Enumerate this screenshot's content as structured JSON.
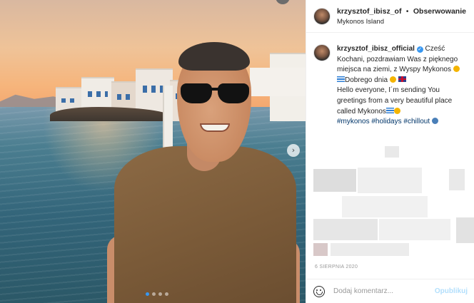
{
  "post": {
    "username": "krzysztof_ibisz_of",
    "bullet": "•",
    "follow_label": "Obserwowanie",
    "location": "Mykonos Island"
  },
  "caption": {
    "username": "krzysztof_ibisz_official",
    "verified_glyph": "✓",
    "line1": " Cześć Kochani, pozdrawiam Was z pięknego miejsca na ziemi, z Wyspy Mykonos",
    "line2": "Dobrego dnia",
    "line3": "Hello everyone, I´m sending You greetings from a very beautiful place called Mykonos",
    "hashtags": [
      "#mykonos",
      "#holidays",
      "#chillout"
    ]
  },
  "date": "6 SIERPNIA 2020",
  "comment": {
    "placeholder": "Dodaj komentarz...",
    "post_label": "Opublikuj"
  },
  "carousel": {
    "next_glyph": "›",
    "slide_count": 4,
    "active_index": 0
  },
  "colors": {
    "link": "#003569",
    "verified": "#3897f0",
    "post_disabled": "#b2dffc"
  },
  "icons": {
    "emoji": "smiley-icon",
    "next": "chevron-right-icon"
  }
}
